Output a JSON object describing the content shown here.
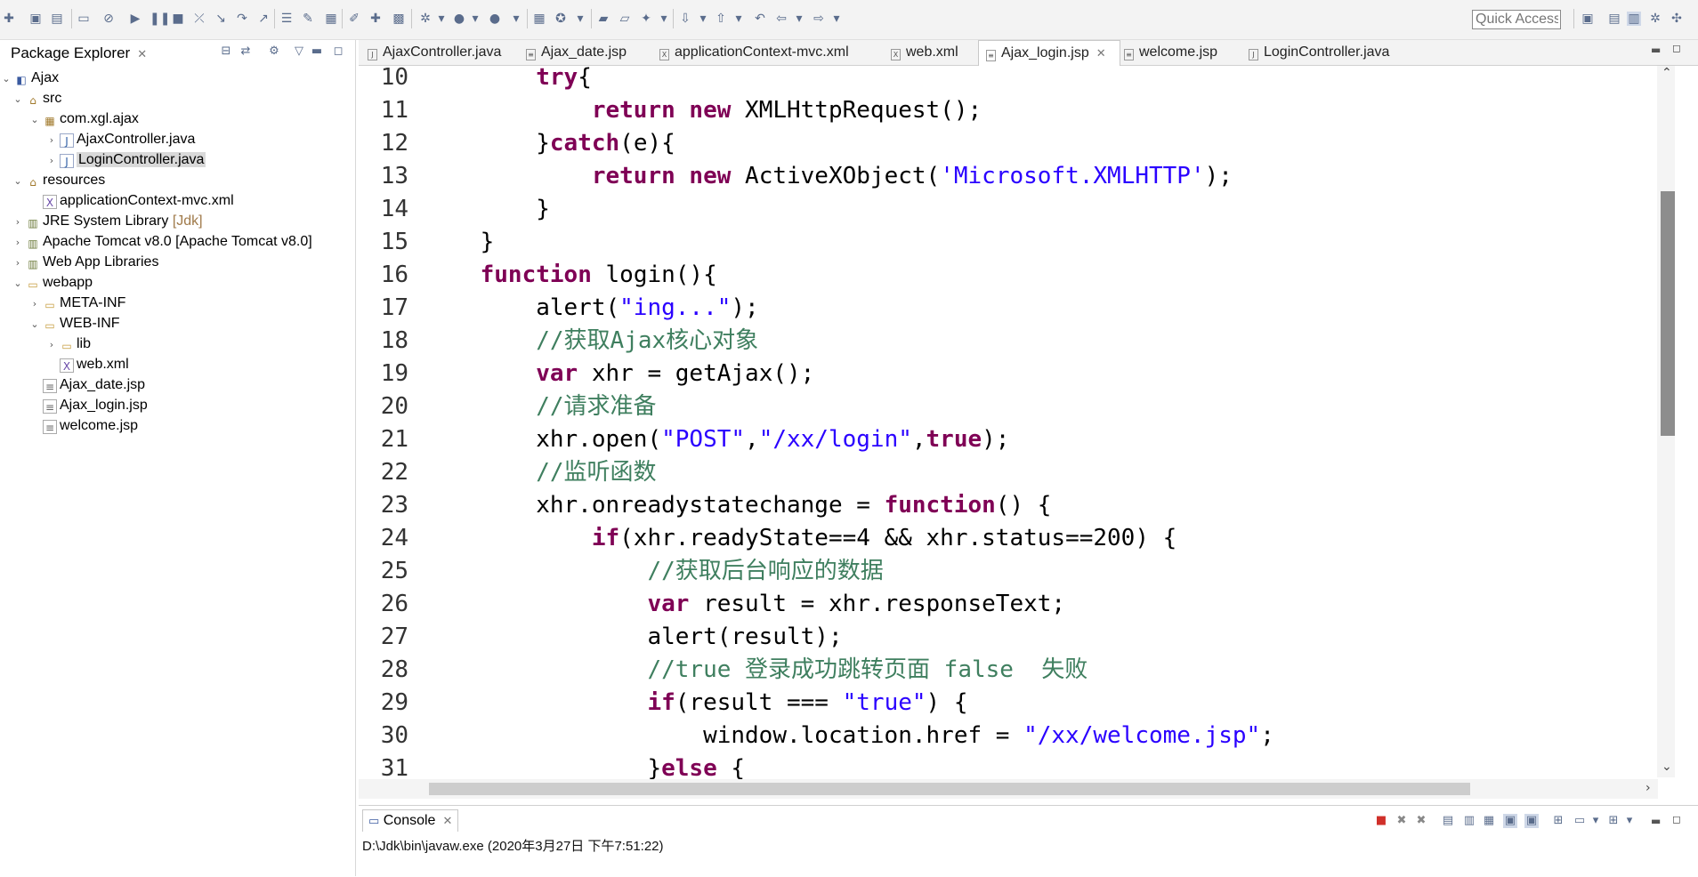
{
  "toolbar": {
    "quick_access_placeholder": "Quick Access"
  },
  "package_explorer": {
    "title": "Package Explorer",
    "tree": [
      {
        "label": "Ajax",
        "icon": "project-icon",
        "chevron": "⌄"
      },
      {
        "label": "src",
        "icon": "source-folder-icon",
        "chevron": "⌄"
      },
      {
        "label": "com.xgl.ajax",
        "icon": "package-icon",
        "chevron": "⌄"
      },
      {
        "label": "AjaxController.java",
        "icon": "java-file-icon",
        "chevron": "›"
      },
      {
        "label": "LoginController.java",
        "icon": "java-file-icon",
        "chevron": "›"
      },
      {
        "label": "resources",
        "icon": "folder-icon",
        "chevron": "⌄"
      },
      {
        "label": "applicationContext-mvc.xml",
        "icon": "xml-file-icon",
        "chevron": ""
      },
      {
        "label": "JRE System Library",
        "suffix": "[Jdk]",
        "icon": "library-icon",
        "chevron": "›"
      },
      {
        "label": "Apache Tomcat v8.0 [Apache Tomcat v8.0]",
        "icon": "library-icon",
        "chevron": "›"
      },
      {
        "label": "Web App Libraries",
        "icon": "library-icon",
        "chevron": "›"
      },
      {
        "label": "webapp",
        "icon": "folder-icon",
        "chevron": "⌄"
      },
      {
        "label": "META-INF",
        "icon": "folder-icon",
        "chevron": "›"
      },
      {
        "label": "WEB-INF",
        "icon": "folder-icon",
        "chevron": "⌄"
      },
      {
        "label": "lib",
        "icon": "folder-icon",
        "chevron": "›"
      },
      {
        "label": "web.xml",
        "icon": "xml-file-icon",
        "chevron": ""
      },
      {
        "label": "Ajax_date.jsp",
        "icon": "jsp-file-icon",
        "chevron": ""
      },
      {
        "label": "Ajax_login.jsp",
        "icon": "jsp-file-icon",
        "chevron": ""
      },
      {
        "label": "welcome.jsp",
        "icon": "jsp-file-icon",
        "chevron": ""
      }
    ]
  },
  "editor_tabs": [
    {
      "label": "AjaxController.java"
    },
    {
      "label": "Ajax_date.jsp"
    },
    {
      "label": "applicationContext-mvc.xml"
    },
    {
      "label": "web.xml"
    },
    {
      "label": "Ajax_login.jsp"
    },
    {
      "label": "welcome.jsp"
    },
    {
      "label": "LoginController.java"
    }
  ],
  "code_lines": [
    {
      "n": "10",
      "t": "        try{"
    },
    {
      "n": "11",
      "t": "            return new XMLHttpRequest();"
    },
    {
      "n": "12",
      "t": "        }catch(e){"
    },
    {
      "n": "13",
      "t": "            return new ActiveXObject('Microsoft.XMLHTTP');"
    },
    {
      "n": "14",
      "t": "        }"
    },
    {
      "n": "15",
      "t": "    }"
    },
    {
      "n": "16",
      "t": "    function login(){"
    },
    {
      "n": "17",
      "t": "        alert(\"ing...\");"
    },
    {
      "n": "18",
      "t": "        //获取Ajax核心对象"
    },
    {
      "n": "19",
      "t": "        var xhr = getAjax();"
    },
    {
      "n": "20",
      "t": "        //请求准备"
    },
    {
      "n": "21",
      "t": "        xhr.open(\"POST\",\"/xx/login\",true);"
    },
    {
      "n": "22",
      "t": "        //监听函数"
    },
    {
      "n": "23",
      "t": "        xhr.onreadystatechange = function() {"
    },
    {
      "n": "24",
      "t": "            if(xhr.readyState==4 && xhr.status==200) {"
    },
    {
      "n": "25",
      "t": "                //获取后台响应的数据"
    },
    {
      "n": "26",
      "t": "                var result = xhr.responseText;"
    },
    {
      "n": "27",
      "t": "                alert(result);"
    },
    {
      "n": "28",
      "t": "                //true 登录成功跳转页面 false  失败"
    },
    {
      "n": "29",
      "t": "                if(result === \"true\") {"
    },
    {
      "n": "30",
      "t": "                    window.location.href = \"/xx/welcome.jsp\";"
    },
    {
      "n": "31",
      "t": "                }else {"
    }
  ],
  "console": {
    "title": "Console",
    "status": "D:\\Jdk\\bin\\javaw.exe (2020年3月27日 下午7:51:22)"
  },
  "colors": {
    "keyword": "#7f0055",
    "string": "#2a00ff",
    "comment": "#3f7f5f"
  }
}
